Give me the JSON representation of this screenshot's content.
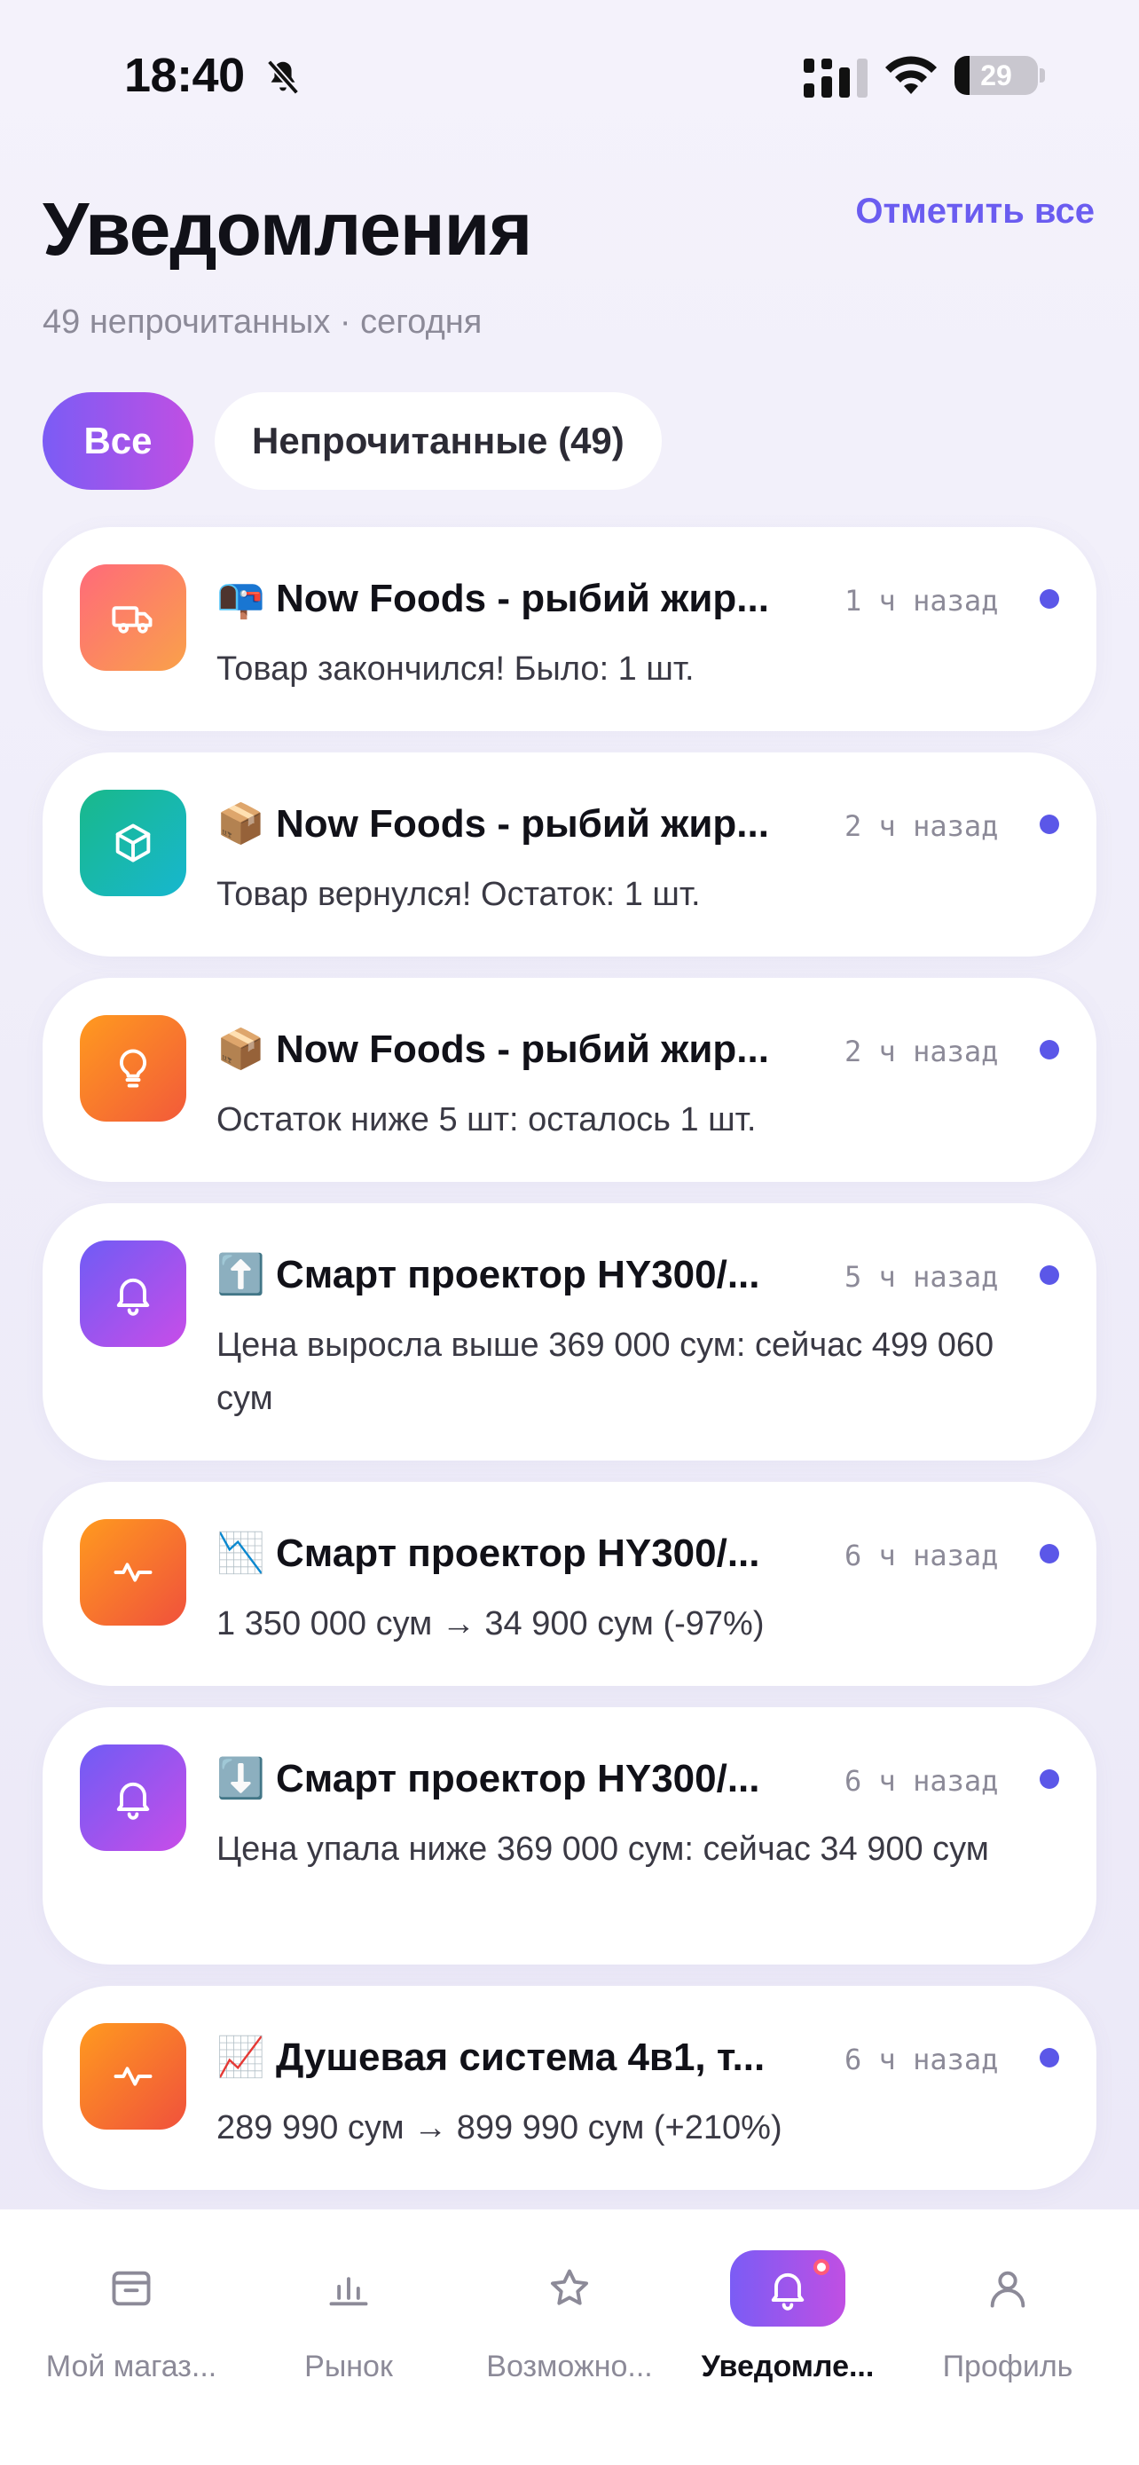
{
  "status_bar": {
    "time": "18:40",
    "battery": "29"
  },
  "header": {
    "title": "Уведомления",
    "subtitle": "49 непрочитанных · сегодня",
    "mark_all": "Отметить все"
  },
  "filters": [
    {
      "label": "Все",
      "active": true
    },
    {
      "label": "Непрочитанные (49)",
      "active": false
    }
  ],
  "notifications": [
    {
      "icon": "truck-icon",
      "title": "📭 Now Foods - рыбий жир...",
      "time": "1 ч назад",
      "body": "Товар закончился! Было: 1 шт.",
      "unread": true
    },
    {
      "icon": "box-icon",
      "title": "📦 Now Foods - рыбий жир...",
      "time": "2 ч назад",
      "body": "Товар вернулся! Остаток: 1 шт.",
      "unread": true
    },
    {
      "icon": "lightbulb-icon",
      "title": "📦 Now Foods - рыбий жир...",
      "time": "2 ч назад",
      "body": "Остаток ниже 5 шт: осталось 1 шт.",
      "unread": true
    },
    {
      "icon": "bell-icon",
      "title": "⬆️ Смарт проектор HY300/...",
      "time": "5 ч назад",
      "body": "Цена выросла выше 369 000 сум: сейчас 499 060 сум",
      "unread": true
    },
    {
      "icon": "pulse-icon",
      "title": "📉 Смарт проектор HY300/...",
      "time": "6 ч назад",
      "body": "1 350 000 сум → 34 900 сум (-97%)",
      "unread": true
    },
    {
      "icon": "bell-icon",
      "title": "⬇️ Смарт проектор HY300/...",
      "time": "6 ч назад",
      "body": "Цена упала ниже 369 000 сум: сейчас 34 900 сум",
      "unread": true
    },
    {
      "icon": "pulse-icon",
      "title": "📈 Душевая система 4в1, т...",
      "time": "6 ч назад",
      "body": "289 990 сум → 899 990 сум (+210%)",
      "unread": true
    }
  ],
  "bottom_nav": [
    {
      "label": "Мой магаз...",
      "icon": "store-icon",
      "active": false
    },
    {
      "label": "Рынок",
      "icon": "bar-chart-icon",
      "active": false
    },
    {
      "label": "Возможно...",
      "icon": "star-icon",
      "active": false
    },
    {
      "label": "Уведомле...",
      "icon": "bell-icon",
      "active": true
    },
    {
      "label": "Профиль",
      "icon": "person-icon",
      "active": false
    }
  ],
  "colors": {
    "accent": "#6a5cf0",
    "unread_dot": "#5b57e8",
    "badge": "#ff5a7a"
  }
}
